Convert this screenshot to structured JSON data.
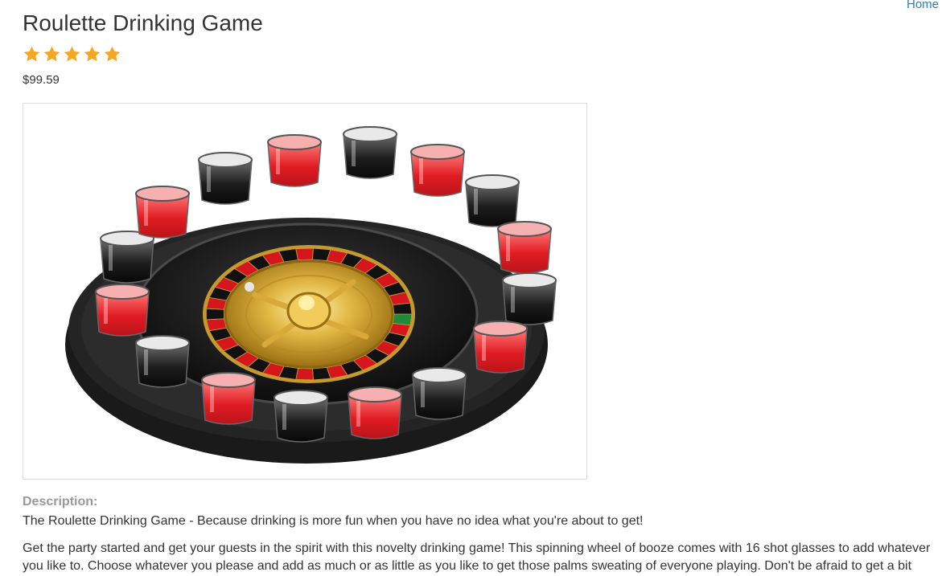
{
  "nav": {
    "home_label": "Home"
  },
  "product": {
    "title": "Roulette Drinking Game",
    "rating_stars": 5,
    "rating_max": 5,
    "price": "$99.59",
    "image_alt": "Roulette Drinking Game",
    "description_label": "Description:",
    "description_tagline": "The Roulette Drinking Game - Because drinking is more fun when you have no idea what you're about to get!",
    "description_body": "Get the party started and get your guests in the spirit with this novelty drinking game! This spinning wheel of booze comes with 16 shot glasses to add whatever you like to. Choose whatever you please and add as much or as little as you like to get those palms sweating of everyone playing. Don't be afraid to get a bit"
  },
  "colors": {
    "link": "#337ab7",
    "star": "#f5a623",
    "label_muted": "#999999",
    "text": "#333333"
  }
}
